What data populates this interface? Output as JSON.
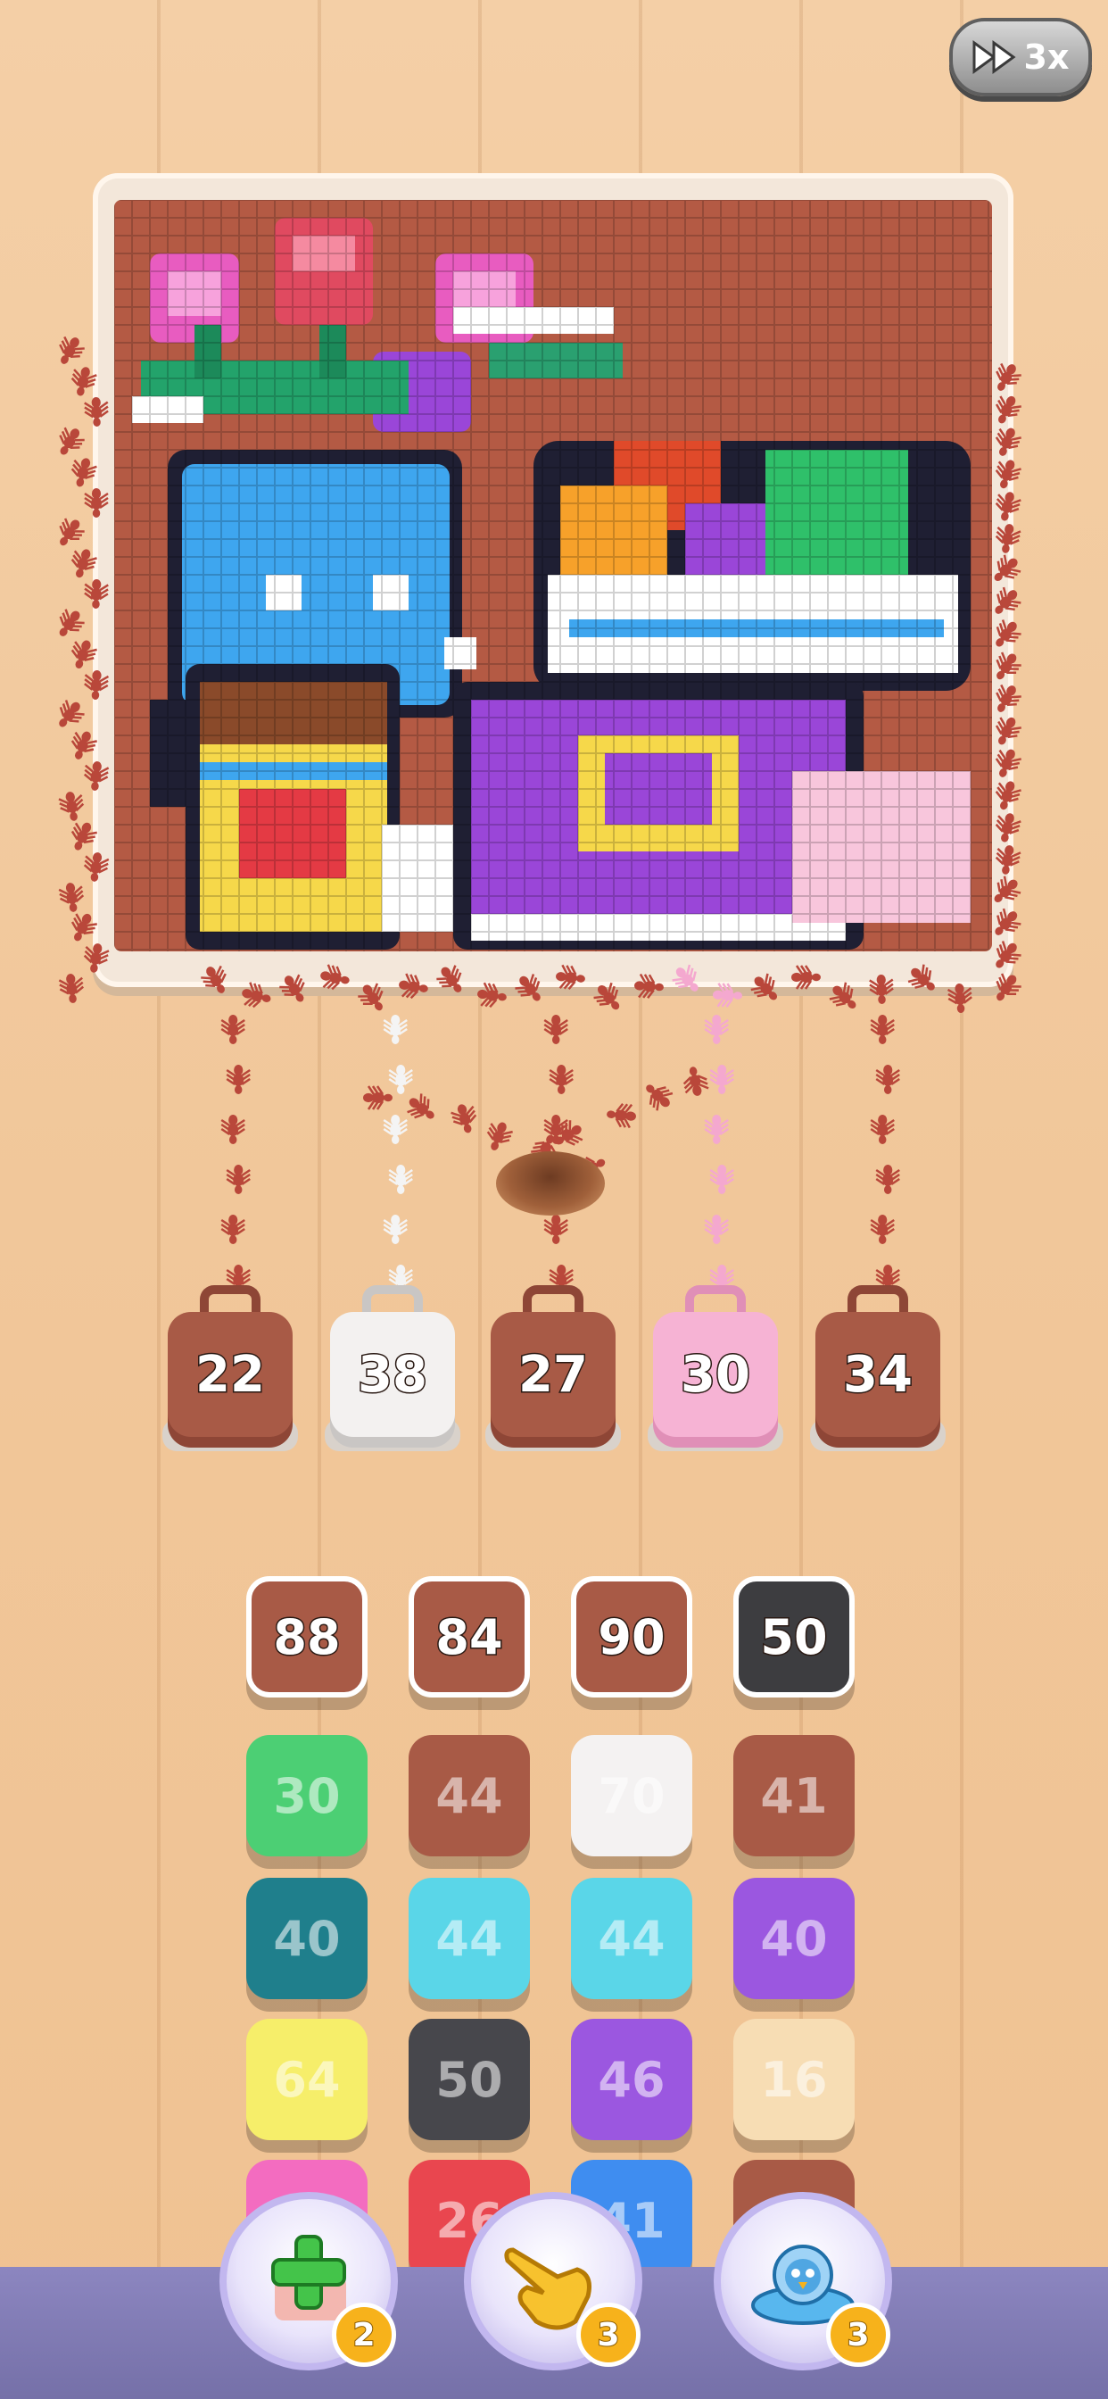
{
  "speed": {
    "label": "3x"
  },
  "jars": [
    {
      "count": "22",
      "color": "#a85a46",
      "handle": "#8e4636"
    },
    {
      "count": "38",
      "color": "#f3f1f0",
      "handle": "#c9c6c4"
    },
    {
      "count": "27",
      "color": "#a85a46",
      "handle": "#8e4636"
    },
    {
      "count": "30",
      "color": "#f6b3d4",
      "handle": "#e08fb7"
    },
    {
      "count": "34",
      "color": "#a85a46",
      "handle": "#8e4636"
    }
  ],
  "tiles": [
    [
      {
        "value": "88",
        "color": "#a85a46",
        "state": "active"
      },
      {
        "value": "84",
        "color": "#a85a46",
        "state": "active"
      },
      {
        "value": "90",
        "color": "#a85a46",
        "state": "active"
      },
      {
        "value": "50",
        "color": "#3d3d40",
        "state": "active"
      }
    ],
    [
      {
        "value": "30",
        "color": "#4ccf74",
        "state": "locked"
      },
      {
        "value": "44",
        "color": "#a85a46",
        "state": "locked"
      },
      {
        "value": "70",
        "color": "#f4f2f2",
        "state": "locked"
      },
      {
        "value": "41",
        "color": "#a85a46",
        "state": "locked"
      }
    ],
    [
      {
        "value": "40",
        "color": "#1f7f8c",
        "state": "locked"
      },
      {
        "value": "44",
        "color": "#5ad6e8",
        "state": "locked"
      },
      {
        "value": "44",
        "color": "#5ad6e8",
        "state": "locked"
      },
      {
        "value": "40",
        "color": "#9b57e0",
        "state": "locked"
      }
    ],
    [
      {
        "value": "64",
        "color": "#f6ee6a",
        "state": "locked"
      },
      {
        "value": "50",
        "color": "#47474c",
        "state": "locked"
      },
      {
        "value": "46",
        "color": "#9b57e0",
        "state": "locked"
      },
      {
        "value": "16",
        "color": "#f7ddb4",
        "state": "locked"
      }
    ],
    [
      {
        "value": "",
        "color": "#f36cc0",
        "state": "locked"
      },
      {
        "value": "26",
        "color": "#e9464f",
        "state": "locked"
      },
      {
        "value": "41",
        "color": "#3f8df0",
        "state": "locked"
      },
      {
        "value": "",
        "color": "#a85a46",
        "state": "locked"
      }
    ]
  ],
  "boosters": [
    {
      "name": "add-tile",
      "count": "2"
    },
    {
      "name": "tap-hand",
      "count": "3"
    },
    {
      "name": "ufo-bird",
      "count": "3"
    }
  ]
}
